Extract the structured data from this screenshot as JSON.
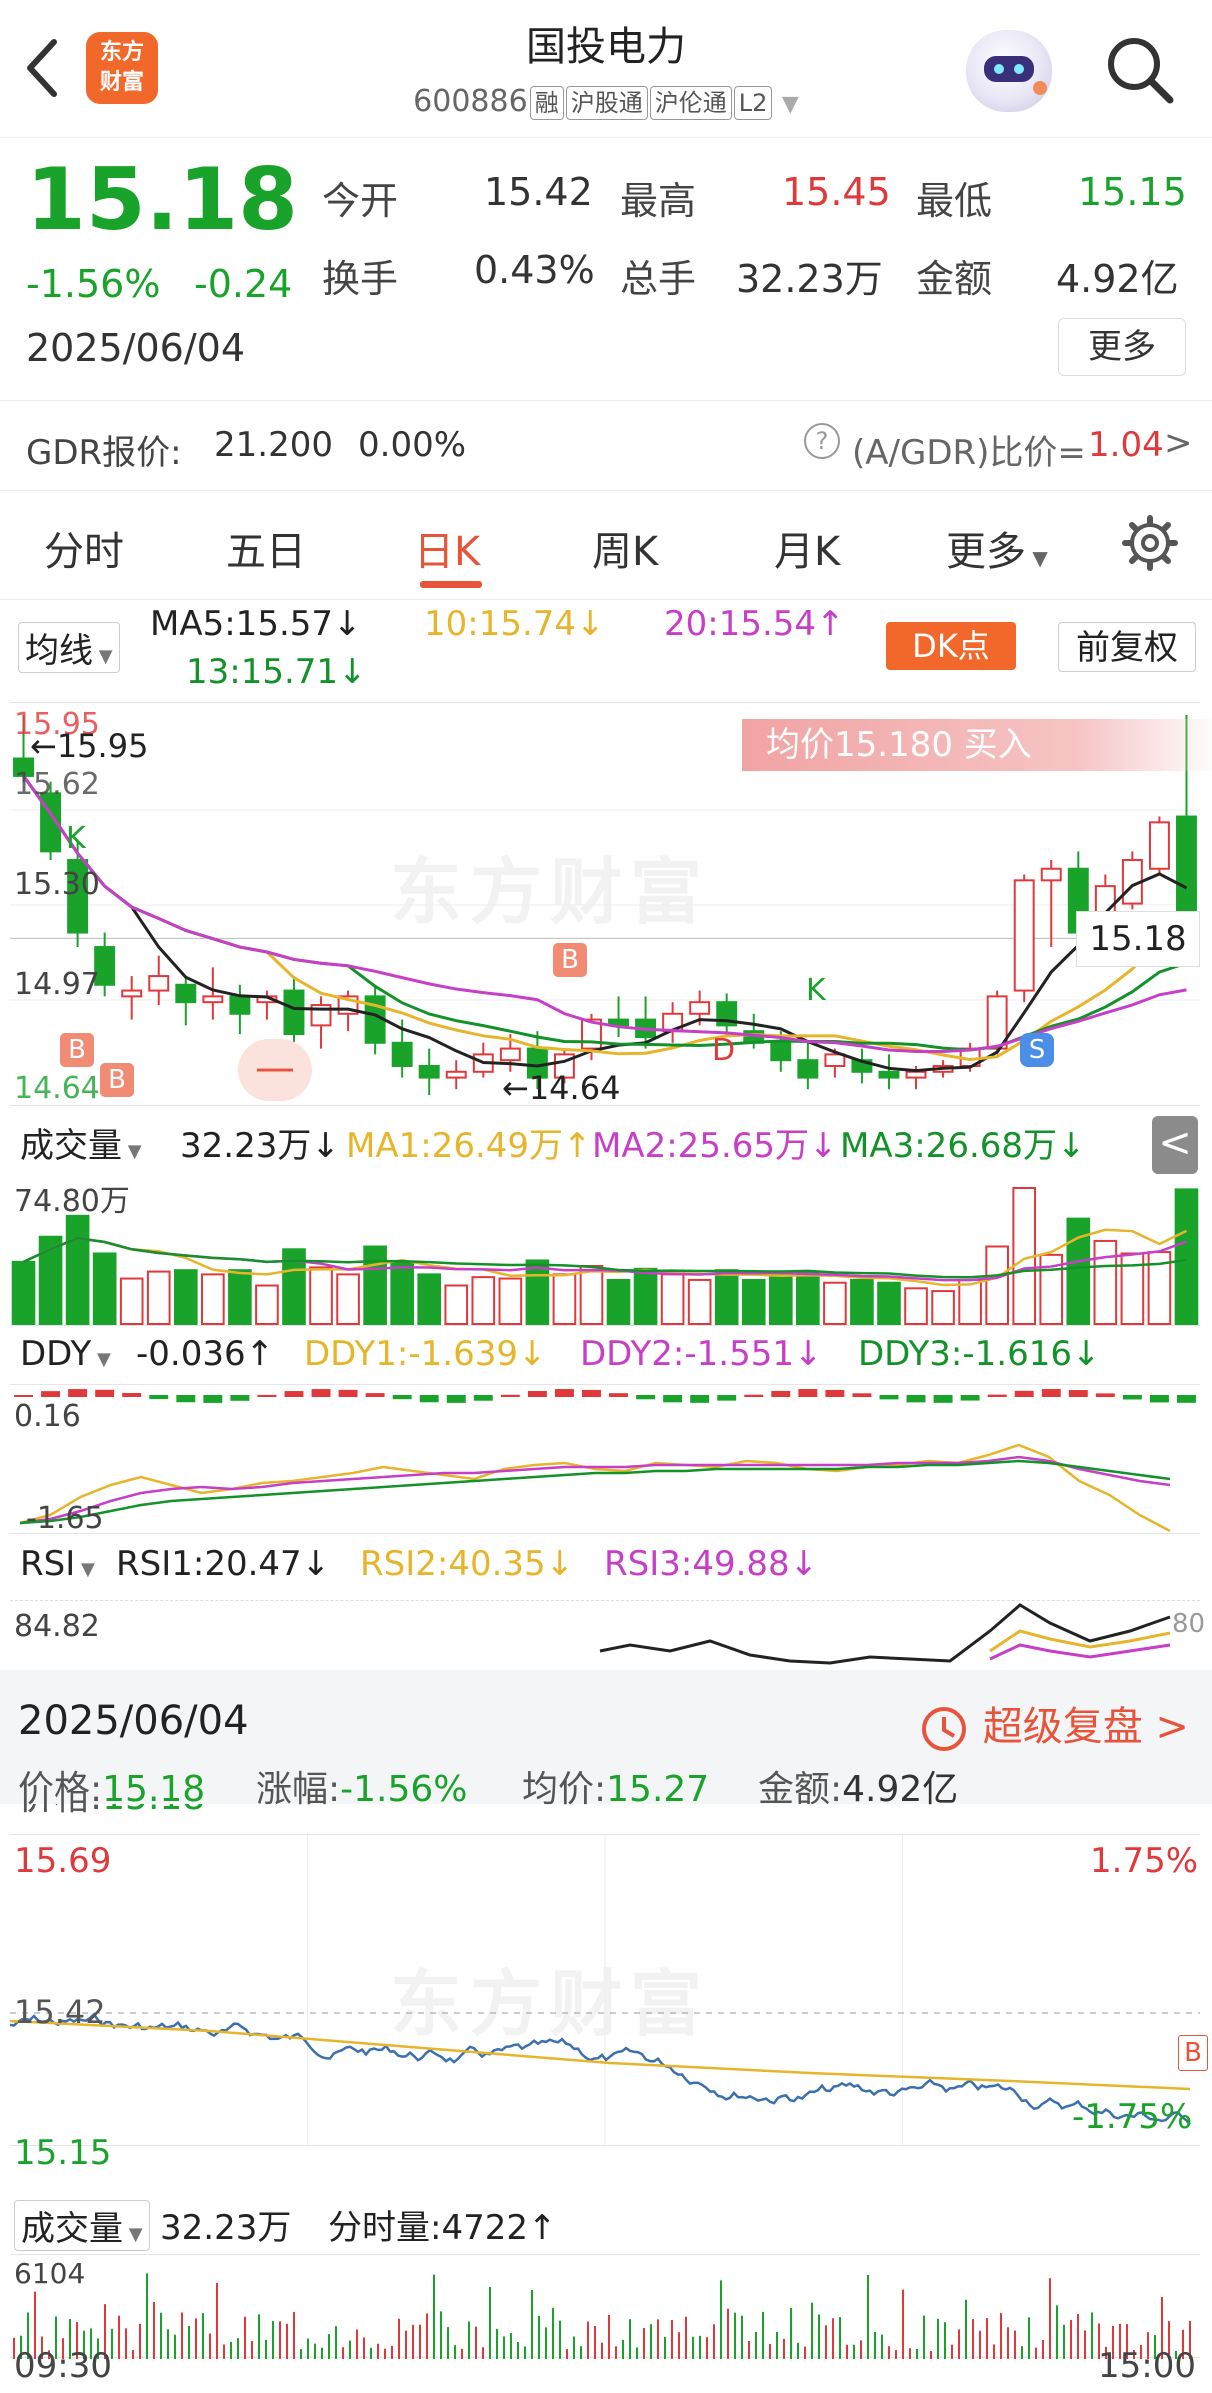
{
  "header": {
    "title": "国投电力",
    "code": "600886",
    "tags": [
      "融",
      "沪股通",
      "沪伦通",
      "L2"
    ],
    "logo_text_1": "东方",
    "logo_text_2": "财富"
  },
  "quote": {
    "price": "15.18",
    "change_pct": "-1.56%",
    "change": "-0.24",
    "date": "2025/06/04",
    "open_label": "今开",
    "open": "15.42",
    "high_label": "最高",
    "high": "15.45",
    "low_label": "最低",
    "low": "15.15",
    "turnover_label": "换手",
    "turnover": "0.43%",
    "volume_label": "总手",
    "volume": "32.23万",
    "amount_label": "金额",
    "amount": "4.92亿",
    "more_label": "更多"
  },
  "gdr": {
    "label": "GDR报价:",
    "price": "21.200",
    "pct": "0.00%",
    "ratio_label": "(A/GDR)比价=",
    "ratio": "1.04",
    "arrow": ">"
  },
  "tabs": [
    {
      "label": "分时"
    },
    {
      "label": "五日"
    },
    {
      "label": "日K"
    },
    {
      "label": "周K"
    },
    {
      "label": "月K"
    },
    {
      "label": "更多"
    }
  ],
  "ma_row": {
    "selector": "均线",
    "ma5": "MA5:15.57",
    "ma10": "10:15.74",
    "ma20": "20:15.54",
    "ma13": "13:15.71",
    "dk_label": "DK点",
    "fq_label": "前复权"
  },
  "kline": {
    "y_top": "15.95",
    "y_2": "15.62",
    "y_3": "15.30",
    "y_4": "14.97",
    "y_bottom": "14.64",
    "high_mark": "←15.95",
    "low_mark": "←14.64",
    "price_tag": "15.18",
    "avg_banner": "均价15.180  买入",
    "watermark": "东方财富",
    "b_marker": "B",
    "k_marker": "K",
    "d_marker": "D",
    "s_marker": "S"
  },
  "volume": {
    "selector": "成交量",
    "value": "32.23万",
    "ma1": "MA1:26.49万",
    "ma2": "MA2:25.65万",
    "ma3": "MA3:26.68万",
    "y_top": "74.80万"
  },
  "ddy": {
    "selector": "DDY",
    "value": "-0.036",
    "ddy1": "DDY1:-1.639",
    "ddy2": "DDY2:-1.551",
    "ddy3": "DDY3:-1.616",
    "y_top": "0.16",
    "y_bottom": "-1.65"
  },
  "rsi": {
    "selector": "RSI",
    "rsi1": "RSI1:20.47",
    "rsi2": "RSI2:40.35",
    "rsi3": "RSI3:49.88",
    "y_top": "84.82",
    "right_label": "80"
  },
  "intraday": {
    "date": "2025/06/04",
    "replay_label": "超级复盘",
    "price_info": "价格:15.18",
    "pct_info": "涨幅:-1.56%",
    "avg_info": "均价:15.27",
    "amt_info": "金额:4.92亿",
    "y_top": "15.69",
    "y_mid": "15.42",
    "y_bottom": "15.15",
    "pct_top": "1.75%",
    "pct_bottom": "-1.75%",
    "vol_selector": "成交量",
    "vol_value": "32.23万",
    "tick_vol": "分时量:4722",
    "vol_max": "6104",
    "time_start": "09:30",
    "time_end": "15:00",
    "watermark": "东方财富",
    "b_marker": "B"
  },
  "colors": {
    "up": "#e0393b",
    "down": "#1aa32b",
    "accent": "#e8543a",
    "ma5": "#222222",
    "ma10": "#e7b52b",
    "ma20": "#c63fc6",
    "ma13": "#14922a"
  },
  "chart_data": [
    {
      "type": "candlestick",
      "title": "日K",
      "ylim": [
        14.64,
        15.95
      ],
      "ohlc": [
        [
          15.8,
          15.95,
          15.72,
          15.74
        ],
        [
          15.68,
          15.72,
          15.45,
          15.48
        ],
        [
          15.45,
          15.52,
          15.15,
          15.2
        ],
        [
          15.15,
          15.2,
          14.98,
          15.02
        ],
        [
          14.98,
          15.05,
          14.9,
          15.0
        ],
        [
          15.0,
          15.12,
          14.95,
          15.05
        ],
        [
          15.02,
          15.05,
          14.88,
          14.96
        ],
        [
          14.96,
          15.08,
          14.9,
          14.98
        ],
        [
          14.98,
          15.02,
          14.85,
          14.92
        ],
        [
          14.96,
          15.0,
          14.9,
          14.98
        ],
        [
          15.0,
          15.05,
          14.82,
          14.85
        ],
        [
          14.88,
          14.98,
          14.8,
          14.95
        ],
        [
          14.92,
          15.0,
          14.86,
          14.98
        ],
        [
          14.98,
          15.02,
          14.78,
          14.82
        ],
        [
          14.82,
          14.9,
          14.7,
          14.74
        ],
        [
          14.74,
          14.8,
          14.64,
          14.7
        ],
        [
          14.7,
          14.76,
          14.66,
          14.72
        ],
        [
          14.72,
          14.82,
          14.7,
          14.78
        ],
        [
          14.76,
          14.85,
          14.72,
          14.8
        ],
        [
          14.8,
          14.86,
          14.66,
          14.7
        ],
        [
          14.7,
          14.8,
          14.68,
          14.78
        ],
        [
          14.8,
          14.92,
          14.76,
          14.9
        ],
        [
          14.9,
          14.98,
          14.84,
          14.88
        ],
        [
          14.9,
          14.98,
          14.8,
          14.84
        ],
        [
          14.86,
          14.96,
          14.82,
          14.92
        ],
        [
          14.92,
          15.0,
          14.88,
          14.96
        ],
        [
          14.96,
          14.99,
          14.84,
          14.88
        ],
        [
          14.86,
          14.92,
          14.8,
          14.82
        ],
        [
          14.82,
          14.86,
          14.72,
          14.76
        ],
        [
          14.76,
          14.82,
          14.66,
          14.7
        ],
        [
          14.74,
          14.8,
          14.7,
          14.78
        ],
        [
          14.76,
          14.8,
          14.68,
          14.72
        ],
        [
          14.72,
          14.78,
          14.66,
          14.7
        ],
        [
          14.7,
          14.74,
          14.66,
          14.72
        ],
        [
          14.72,
          14.76,
          14.7,
          14.74
        ],
        [
          14.74,
          14.82,
          14.72,
          14.8
        ],
        [
          14.8,
          15.0,
          14.78,
          14.98
        ],
        [
          15.0,
          15.4,
          14.96,
          15.38
        ],
        [
          15.38,
          15.45,
          15.15,
          15.42
        ],
        [
          15.42,
          15.48,
          15.1,
          15.2
        ],
        [
          15.2,
          15.4,
          15.12,
          15.36
        ],
        [
          15.3,
          15.48,
          15.28,
          15.45
        ],
        [
          15.42,
          15.6,
          15.4,
          15.58
        ],
        [
          15.6,
          15.95,
          15.56,
          15.18
        ]
      ]
    },
    {
      "type": "line",
      "title": "分时",
      "ylim": [
        15.15,
        15.69
      ],
      "x": [
        "09:30",
        "15:00"
      ],
      "series": []
    }
  ]
}
